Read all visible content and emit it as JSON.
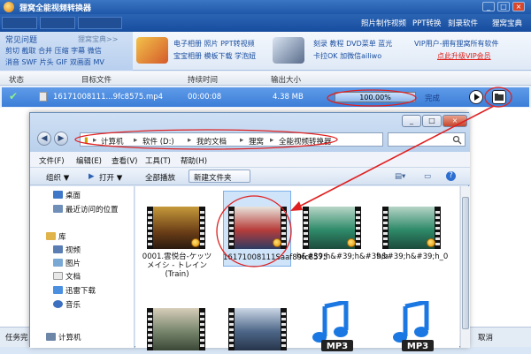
{
  "app": {
    "title": "狸窝全能视频转换器",
    "top_links": [
      "照片制作视频",
      "PPT转换",
      "刻录软件",
      "狸窝宝典"
    ],
    "faq": {
      "heading": "常见问题",
      "more": "狸窝宝典>>",
      "lines": [
        "剪切 截取 合并 压缩 字幕 微信",
        "消音 SWF 片头 GIF 双画面 MV"
      ]
    },
    "ads": [
      {
        "line1": "电子相册 照片 PPT转视频",
        "line2": "宝宝相册 模板下载 学泡妞"
      },
      {
        "line1": "刻录 教程 DVD菜单 蓝光",
        "line2": "卡拉OK 加微信ailiwo"
      }
    ],
    "vip": {
      "line1": "VIP用户-拥有狸窝所有软件",
      "line2": "点此升级VIP会员"
    },
    "columns": [
      "状态",
      "目标文件",
      "持续时间",
      "输出大小"
    ],
    "row": {
      "filename": "16171008111...9fc8575.mp4",
      "duration": "00:00:08",
      "size": "4.38 MB",
      "progress_pct": 100,
      "progress_text": "100.00%",
      "complete_text": "完成"
    },
    "status": {
      "left": "任务完",
      "right": "取消"
    }
  },
  "explorer": {
    "path": [
      "计算机",
      "软件 (D:)",
      "我的文档",
      "狸窝",
      "全能视频转换器"
    ],
    "menu": [
      "文件(F)",
      "编辑(E)",
      "查看(V)",
      "工具(T)",
      "帮助(H)"
    ],
    "toolbar": {
      "organize": "组织 ▼",
      "open": "打开 ▼",
      "play": "全部播放",
      "new_folder": "新建文件夹"
    },
    "nav": {
      "favorites": [
        "桌面",
        "最近访问的位置"
      ],
      "library": "库",
      "library_items": [
        "视频",
        "图片",
        "文档",
        "迅雷下载",
        "音乐"
      ],
      "computer": "计算机"
    },
    "files": [
      {
        "label": "0001.雲悦台-ケッツメイシ - トレイン (Train)"
      },
      {
        "label": "16171008111Saaf89fc8575"
      },
      {
        "label": "h&#39;h&#39;h&#39;h"
      },
      {
        "label": "h&#39;h&#39;h_0"
      }
    ],
    "mp3_label": "MP3"
  }
}
